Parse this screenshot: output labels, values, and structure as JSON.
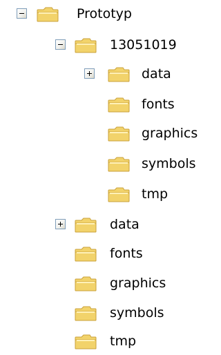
{
  "tree": {
    "root": {
      "label": "Prototyp",
      "expanded": true,
      "children": [
        {
          "label": "13051019",
          "expanded": true,
          "children": [
            {
              "label": "data",
              "expanded": false
            },
            {
              "label": "fonts"
            },
            {
              "label": "graphics"
            },
            {
              "label": "symbols"
            },
            {
              "label": "tmp"
            }
          ]
        },
        {
          "label": "data",
          "expanded": false
        },
        {
          "label": "fonts"
        },
        {
          "label": "graphics"
        },
        {
          "label": "symbols"
        },
        {
          "label": "tmp"
        }
      ]
    }
  },
  "colors": {
    "folder_body": "#f2d36b",
    "folder_edge": "#c9a13b",
    "folder_highlight": "#fff1b8",
    "expander_border": "#7f9db9"
  },
  "icons": {
    "folder": "folder-icon",
    "expand": "plus-icon",
    "collapse": "minus-icon"
  }
}
